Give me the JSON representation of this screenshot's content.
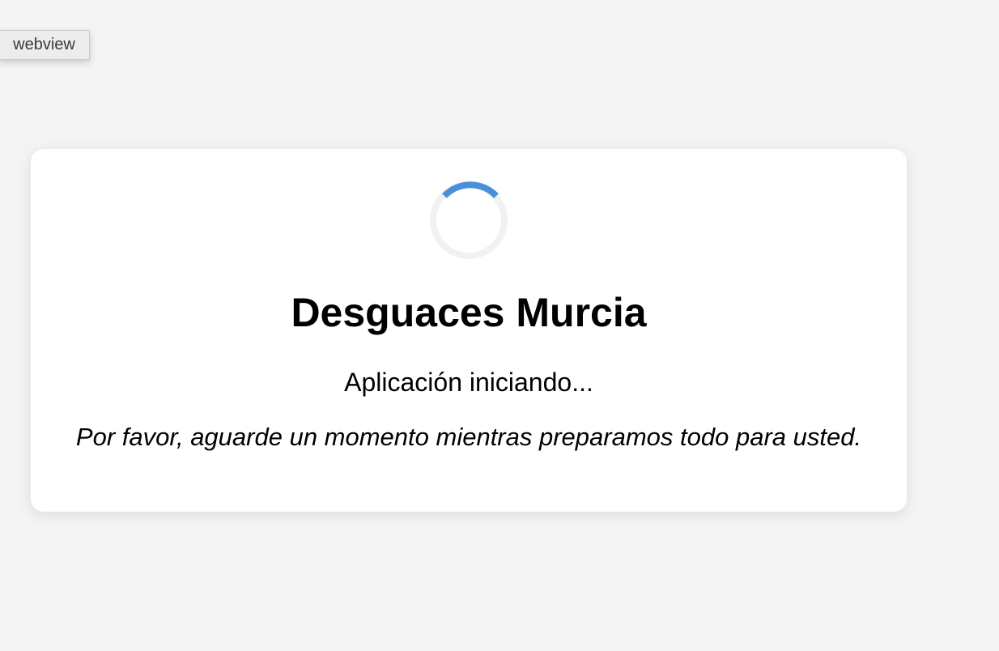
{
  "webview_tag": {
    "label": "webview"
  },
  "loading_card": {
    "spinner_icon": "loading-spinner",
    "title": "Desguaces Murcia",
    "status": "Aplicación iniciando...",
    "message": "Por favor, aguarde un momento mientras preparamos todo para usted."
  },
  "colors": {
    "background": "#f4f4f4",
    "card": "#ffffff",
    "spinner_track": "#f1f1f1",
    "spinner_accent": "#4a90d9",
    "text": "#000000"
  }
}
